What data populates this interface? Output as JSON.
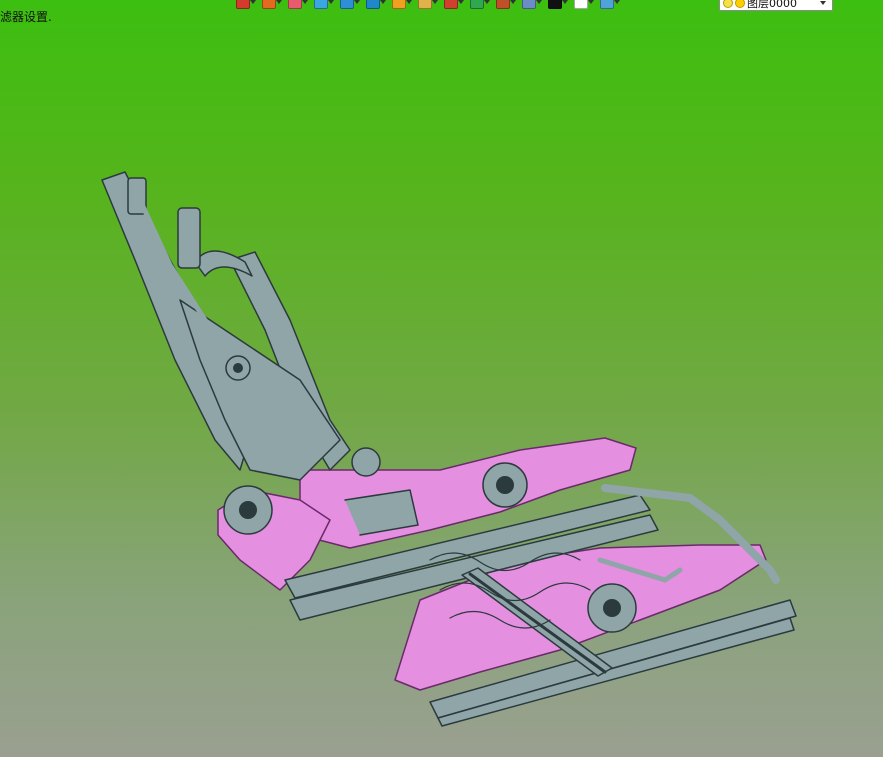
{
  "viewport": {
    "filter_label": "滤器设置."
  },
  "toolbar": {
    "buttons": [
      {
        "icon": "pick-filter-icon",
        "color": "#d33b2c"
      },
      {
        "icon": "move-tool-icon",
        "color": "#e36b1f"
      },
      {
        "icon": "sketch-pencil-icon",
        "color": "#e85b6e"
      },
      {
        "icon": "solid-cube-icon",
        "color": "#3ba7e0"
      },
      {
        "icon": "view-cube-icon",
        "color": "#2d8fd6"
      },
      {
        "icon": "render-cube-icon",
        "color": "#1e88c8"
      },
      {
        "icon": "section-view-icon",
        "color": "#f0a020"
      },
      {
        "icon": "clipboard-icon",
        "color": "#e2b24a"
      },
      {
        "icon": "triad-axis-icon",
        "color": "#d0402e"
      },
      {
        "icon": "snap-grid-icon",
        "color": "#2fa84f"
      },
      {
        "icon": "frame-view-icon",
        "color": "#c0502a"
      },
      {
        "icon": "display-monitor-icon",
        "color": "#6b8cc4"
      },
      {
        "icon": "color-swatch-icon",
        "color": "#111111"
      },
      {
        "icon": "new-sheet-icon",
        "color": "#ffffff"
      },
      {
        "icon": "layer-stack-icon",
        "color": "#4fa3d9"
      }
    ],
    "layer_select": {
      "value": "图层0000"
    }
  },
  "colors": {
    "frame_gray": "#8fa5a8",
    "frame_edge": "#2b3a3d",
    "pan_pink": "#e58fe0",
    "pan_edge": "#6a2a6a"
  }
}
